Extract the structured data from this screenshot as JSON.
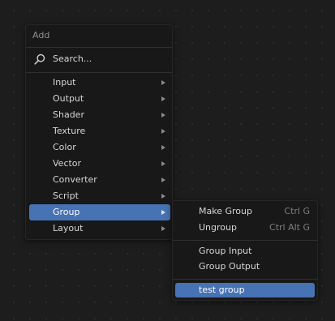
{
  "add_menu": {
    "title": "Add",
    "search_label": "Search...",
    "items": [
      {
        "label": "Input"
      },
      {
        "label": "Output"
      },
      {
        "label": "Shader"
      },
      {
        "label": "Texture"
      },
      {
        "label": "Color"
      },
      {
        "label": "Vector"
      },
      {
        "label": "Converter"
      },
      {
        "label": "Script"
      },
      {
        "label": "Group",
        "active": true
      },
      {
        "label": "Layout"
      }
    ]
  },
  "group_submenu": {
    "items": [
      {
        "label": "Make Group",
        "shortcut": "Ctrl G"
      },
      {
        "label": "Ungroup",
        "shortcut": "Ctrl Alt G"
      },
      {
        "label": "Group Input"
      },
      {
        "label": "Group Output"
      },
      {
        "label": "test group",
        "active": true
      }
    ]
  },
  "colors": {
    "background": "#1d1d1d",
    "menu_background": "#181818",
    "highlight": "#4772b3"
  },
  "icons": {
    "search": "search-icon",
    "submenu_arrow": "chevron-right-icon"
  }
}
